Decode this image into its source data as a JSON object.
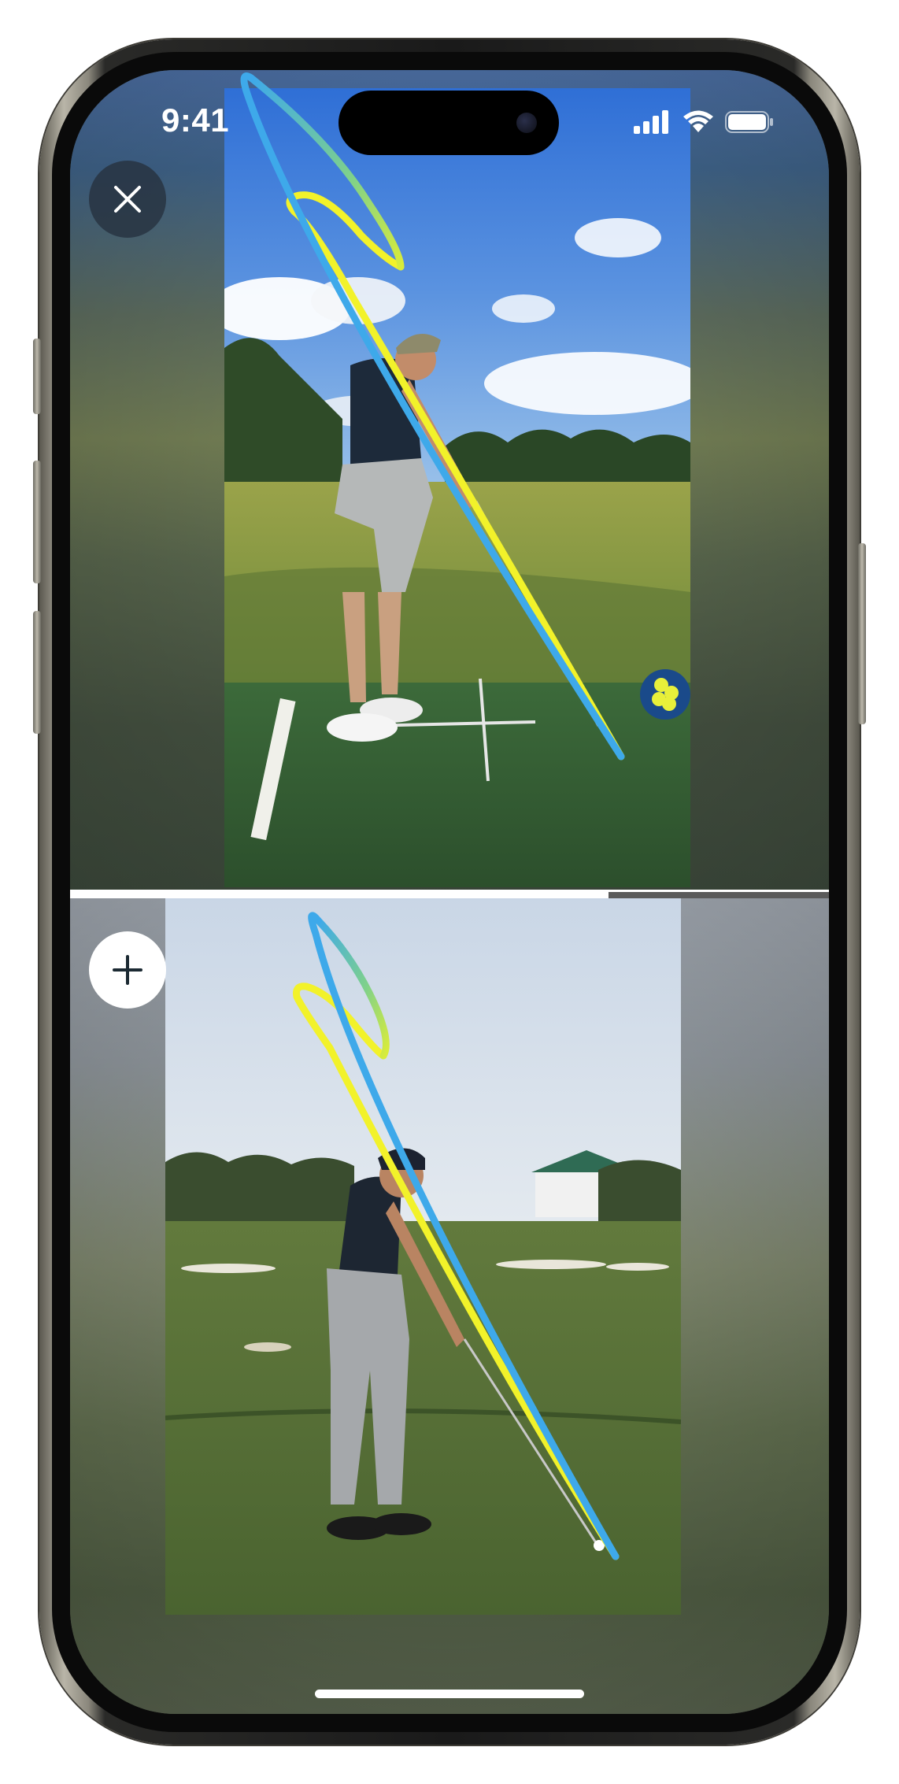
{
  "status_bar": {
    "time": "9:41",
    "icons": [
      "cellular-signal-icon",
      "wifi-icon",
      "battery-icon"
    ]
  },
  "controls": {
    "close_icon": "close-icon",
    "add_icon": "plus-icon"
  },
  "videos": [
    {
      "id": "user-swing",
      "position": "top"
    },
    {
      "id": "reference-swing",
      "position": "bottom"
    }
  ],
  "overlay": {
    "backswing_trace_color": "#3ea9ea",
    "downswing_trace_color": "#f2f22a",
    "gradient_accent_color": "#8fd36a"
  },
  "playback": {
    "progress": 0.71
  },
  "colors": {
    "status_text": "#ffffff",
    "divider": "#ffffff",
    "progress_remaining": "#5a5a5a"
  }
}
